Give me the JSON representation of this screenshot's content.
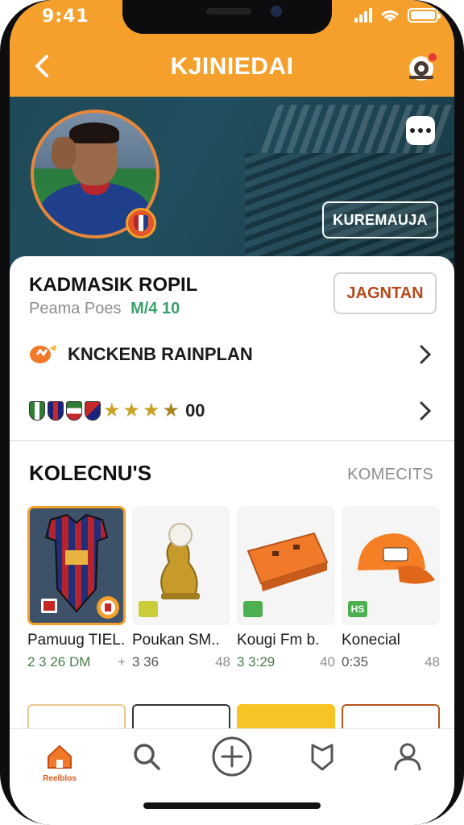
{
  "status_bar": {
    "time": "9:41"
  },
  "nav": {
    "title": "KJINIEDAI"
  },
  "hero": {
    "action_label": "KUREMAUJA"
  },
  "profile": {
    "name": "KADMASIK ROPIL",
    "subtitle": "Peama Poes",
    "stat": "M/4 10",
    "follow_label": "JAGNTAN",
    "row_1_label": "KNCKENB RAINPLAN",
    "badges_count": "00"
  },
  "collection": {
    "title": "KOLECNU'S",
    "see_all": "KOMECITS",
    "items": [
      {
        "name": "Pamuug TIEL.",
        "price": "2 3 26 DM",
        "extra": "+",
        "tag": ""
      },
      {
        "name": "Poukan SM..",
        "price": "3 36",
        "extra": "48",
        "tag": ""
      },
      {
        "name": "Kougi Fm b.",
        "price": "3 3:29",
        "extra": "40",
        "tag": ""
      },
      {
        "name": "Konecial",
        "price": "0:35",
        "extra": "48",
        "tag": "HS"
      }
    ]
  },
  "tabbar": {
    "home_label": "Reelblos"
  },
  "colors": {
    "accent": "#f5a02c",
    "hero_bg": "#1f4a5a",
    "follow_text": "#b64a1c"
  },
  "icons": [
    "back-chevron-icon",
    "notification-bell-icon",
    "more-dots-icon",
    "club-crest-icon",
    "chevron-right-icon",
    "home-icon",
    "search-icon",
    "add-circle-icon",
    "shield-icon",
    "user-icon"
  ]
}
